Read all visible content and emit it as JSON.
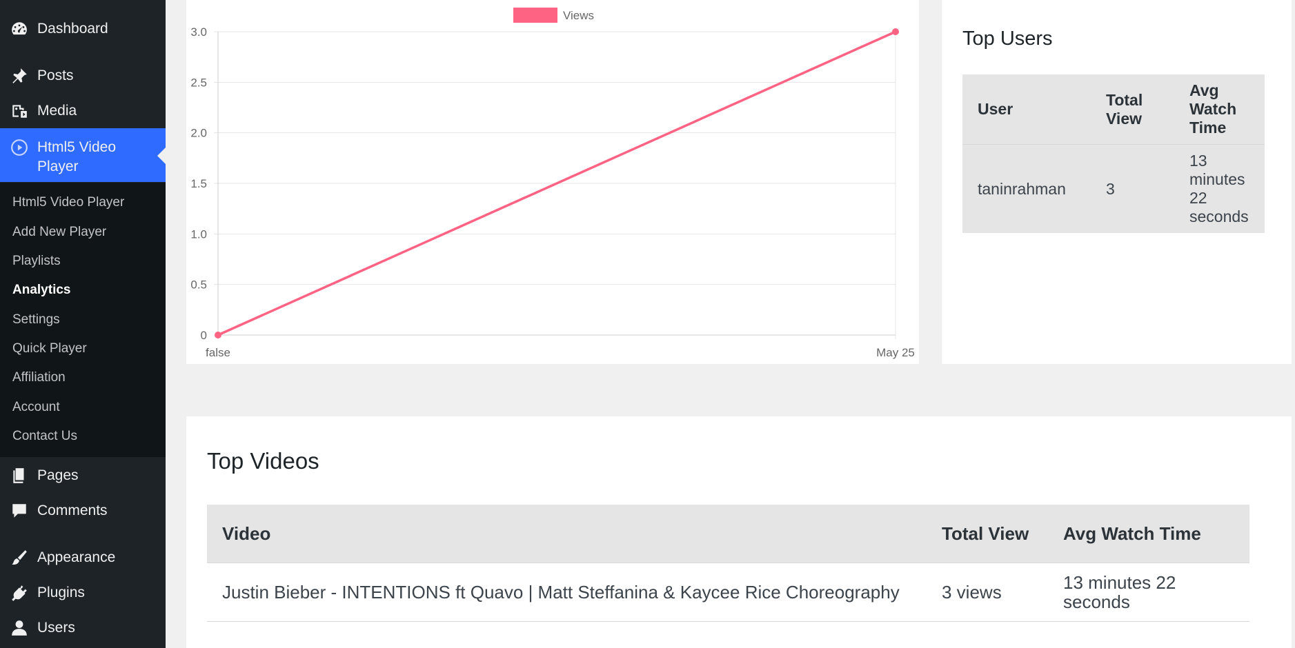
{
  "sidebar": {
    "menu": {
      "dashboard": "Dashboard",
      "posts": "Posts",
      "media": "Media",
      "html5_video_player": "Html5 Video Player",
      "pages": "Pages",
      "comments": "Comments",
      "appearance": "Appearance",
      "plugins": "Plugins",
      "users": "Users"
    },
    "submenu": [
      "Html5 Video Player",
      "Add New Player",
      "Playlists",
      "Analytics",
      "Settings",
      "Quick Player",
      "Affiliation",
      "Account",
      "Contact Us"
    ],
    "current_submenu": "Analytics",
    "active_color": "#2f6bff"
  },
  "chart_data": {
    "type": "line",
    "legend": [
      "Views"
    ],
    "legend_placement": "top-center",
    "x": [
      "false",
      "May 25"
    ],
    "series": [
      {
        "name": "Views",
        "values": [
          0,
          3
        ],
        "color": "#ff6384"
      }
    ],
    "ylim": [
      0,
      3.0
    ],
    "yticks": [
      "0",
      "0.5",
      "1.0",
      "1.5",
      "2.0",
      "2.5",
      "3.0"
    ],
    "grid": true
  },
  "top_users": {
    "title": "Top Users",
    "headers": [
      "User",
      "Total View",
      "Avg Watch Time"
    ],
    "rows": [
      [
        "taninrahman",
        "3",
        "13 minutes 22 seconds"
      ]
    ]
  },
  "top_videos": {
    "title": "Top Videos",
    "headers": [
      "Video",
      "Total View",
      "Avg Watch Time"
    ],
    "rows": [
      [
        "Justin Bieber - INTENTIONS ft Quavo | Matt Steffanina & Kaycee Rice Choreography",
        "3 views",
        "13 minutes 22 seconds"
      ]
    ]
  }
}
